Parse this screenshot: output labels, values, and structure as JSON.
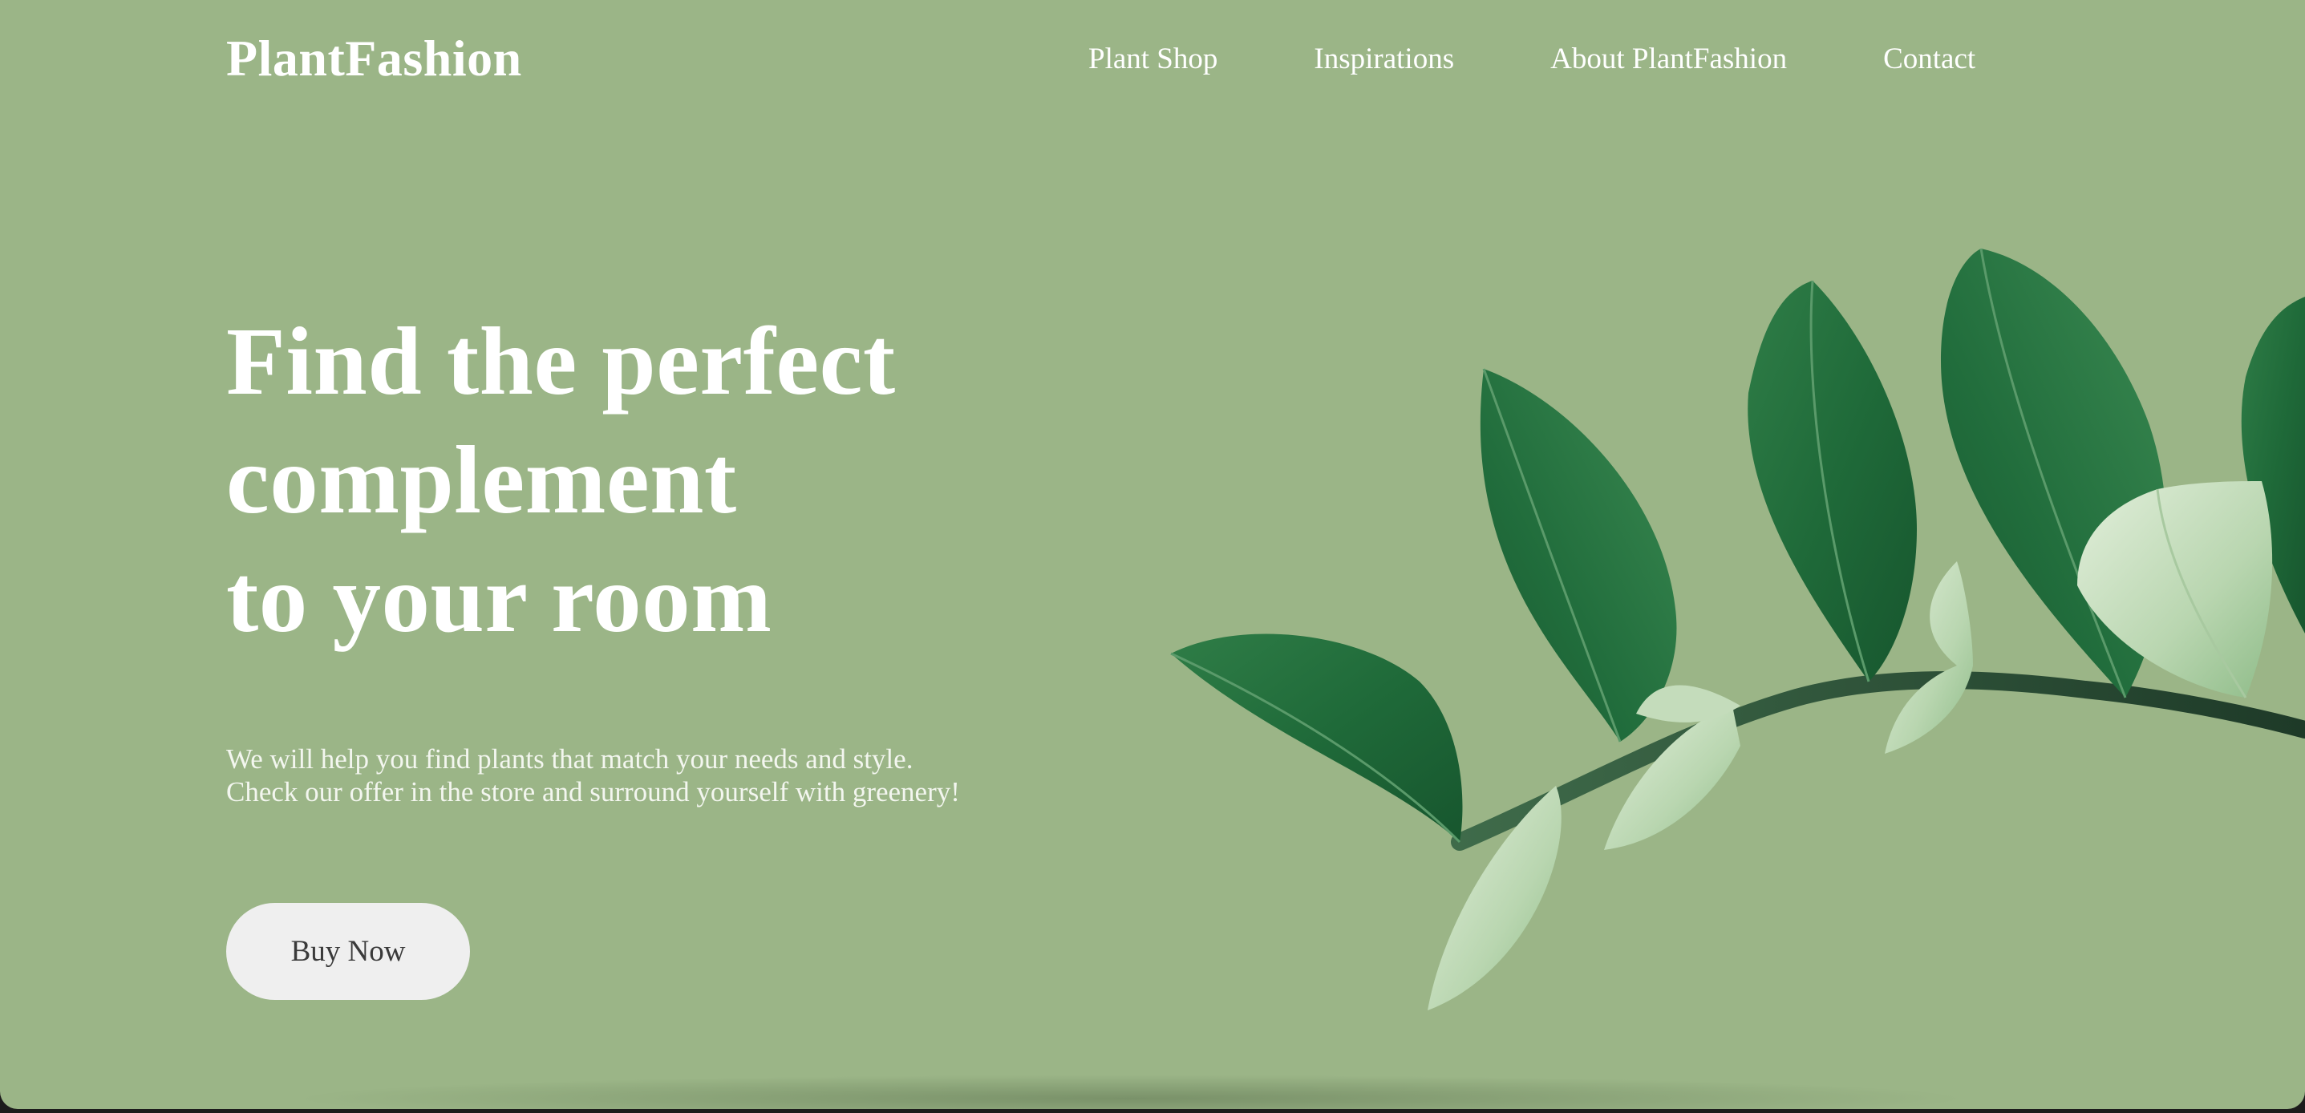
{
  "brand": {
    "logo": "PlantFashion"
  },
  "nav": {
    "items": [
      {
        "label": "Plant Shop"
      },
      {
        "label": "Inspirations"
      },
      {
        "label": "About PlantFashion"
      },
      {
        "label": "Contact"
      }
    ]
  },
  "hero": {
    "headline_lines": [
      "Find the perfect",
      "complement",
      "to your room"
    ],
    "description_lines": [
      "We will help you find plants that match your needs and style.",
      "Check our offer in the store and surround yourself with greenery!"
    ],
    "cta_label": "Buy Now",
    "image_icon": "plant-branch-illustration"
  },
  "colors": {
    "background": "#9bb587",
    "text": "#ffffff",
    "button_bg": "#efefef",
    "button_text": "#3a3a3a",
    "leaf_dark": "#1f6b3a",
    "leaf_light": "#cfe3c6"
  }
}
